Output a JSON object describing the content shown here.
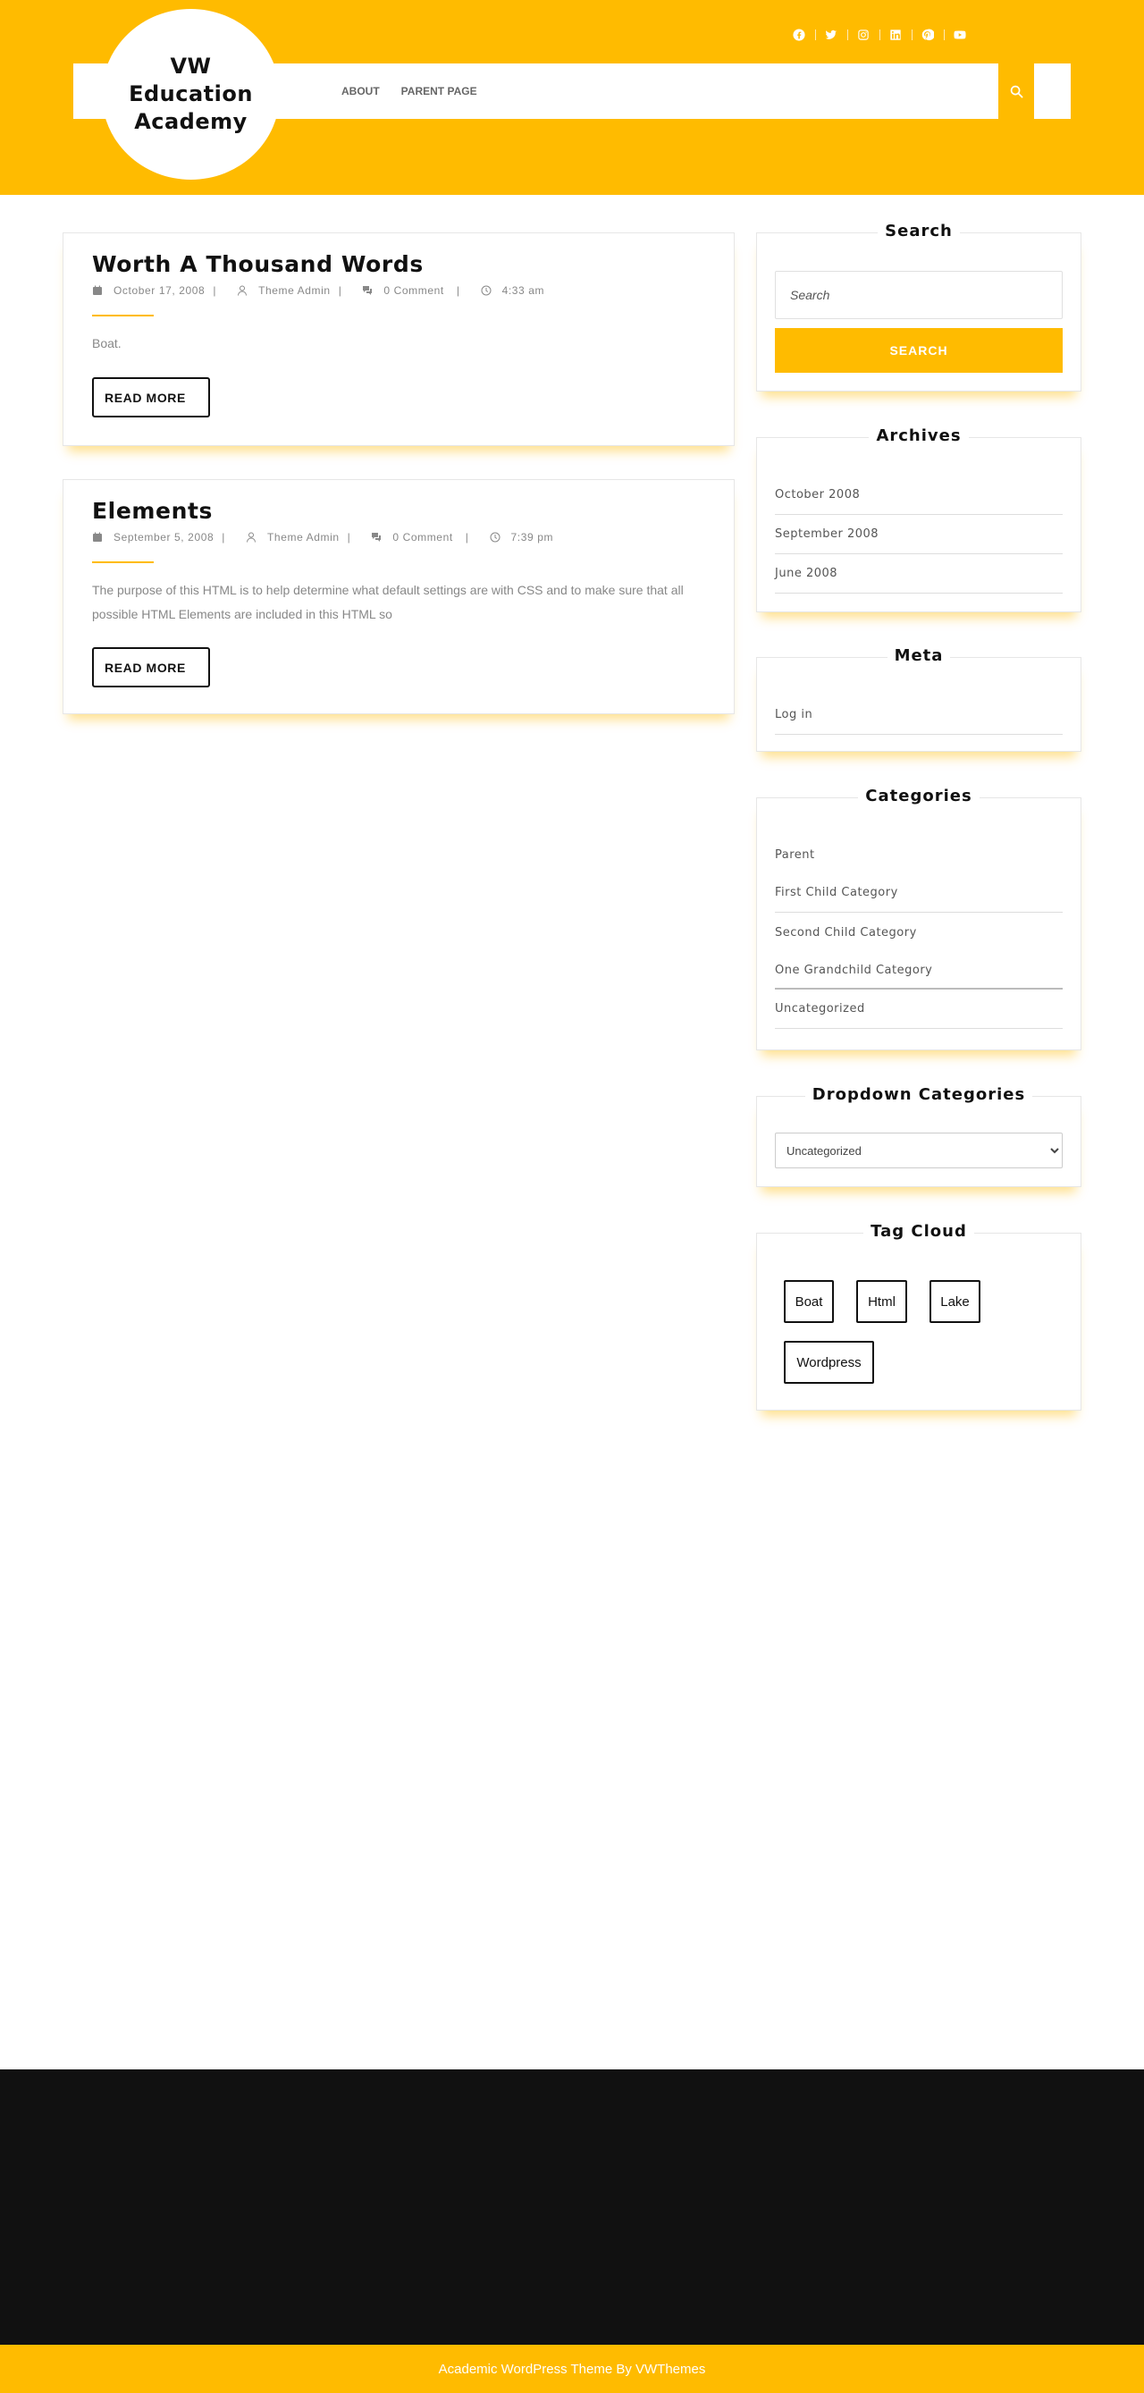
{
  "colors": {
    "accent": "#ffbb00",
    "footer_bg": "#111111",
    "text": "#111111",
    "muted": "#888888"
  },
  "header": {
    "logo_text": "VW Education Academy",
    "social_icons": [
      "facebook-icon",
      "twitter-icon",
      "instagram-icon",
      "linkedin-icon",
      "pinterest-icon",
      "youtube-icon"
    ],
    "nav": [
      "ABOUT",
      "PARENT PAGE"
    ],
    "search_icon": "search-icon"
  },
  "posts": [
    {
      "title": "Worth A Thousand Words",
      "date": "October 17, 2008",
      "author": "Theme Admin",
      "comments": "0 Comment",
      "time": "4:33 am",
      "excerpt": "Boat.",
      "read_more": "READ MORE"
    },
    {
      "title": "Elements",
      "date": "September 5, 2008",
      "author": "Theme Admin",
      "comments": "0 Comment",
      "time": "7:39 pm",
      "excerpt": "The purpose of this HTML is to help determine what default settings are with CSS and to make sure that all possible HTML Elements are included in this HTML so",
      "read_more": "READ MORE"
    }
  ],
  "sidebar": {
    "search": {
      "title": "Search",
      "placeholder": "Search",
      "button": "SEARCH"
    },
    "archives": {
      "title": "Archives",
      "items": [
        "October 2008",
        "September 2008",
        "June 2008"
      ]
    },
    "meta": {
      "title": "Meta",
      "items": [
        "Log in"
      ]
    },
    "categories": {
      "title": "Categories",
      "items": [
        "Parent",
        "First Child Category",
        "Second Child Category",
        "One Grandchild Category",
        "Uncategorized"
      ]
    },
    "dropdown_categories": {
      "title": "Dropdown Categories",
      "selected": "Uncategorized"
    },
    "tag_cloud": {
      "title": "Tag Cloud",
      "tags": [
        "Boat",
        "Html",
        "Lake",
        "Wordpress"
      ]
    }
  },
  "footer": {
    "copyright": "Academic WordPress Theme By VWThemes"
  }
}
